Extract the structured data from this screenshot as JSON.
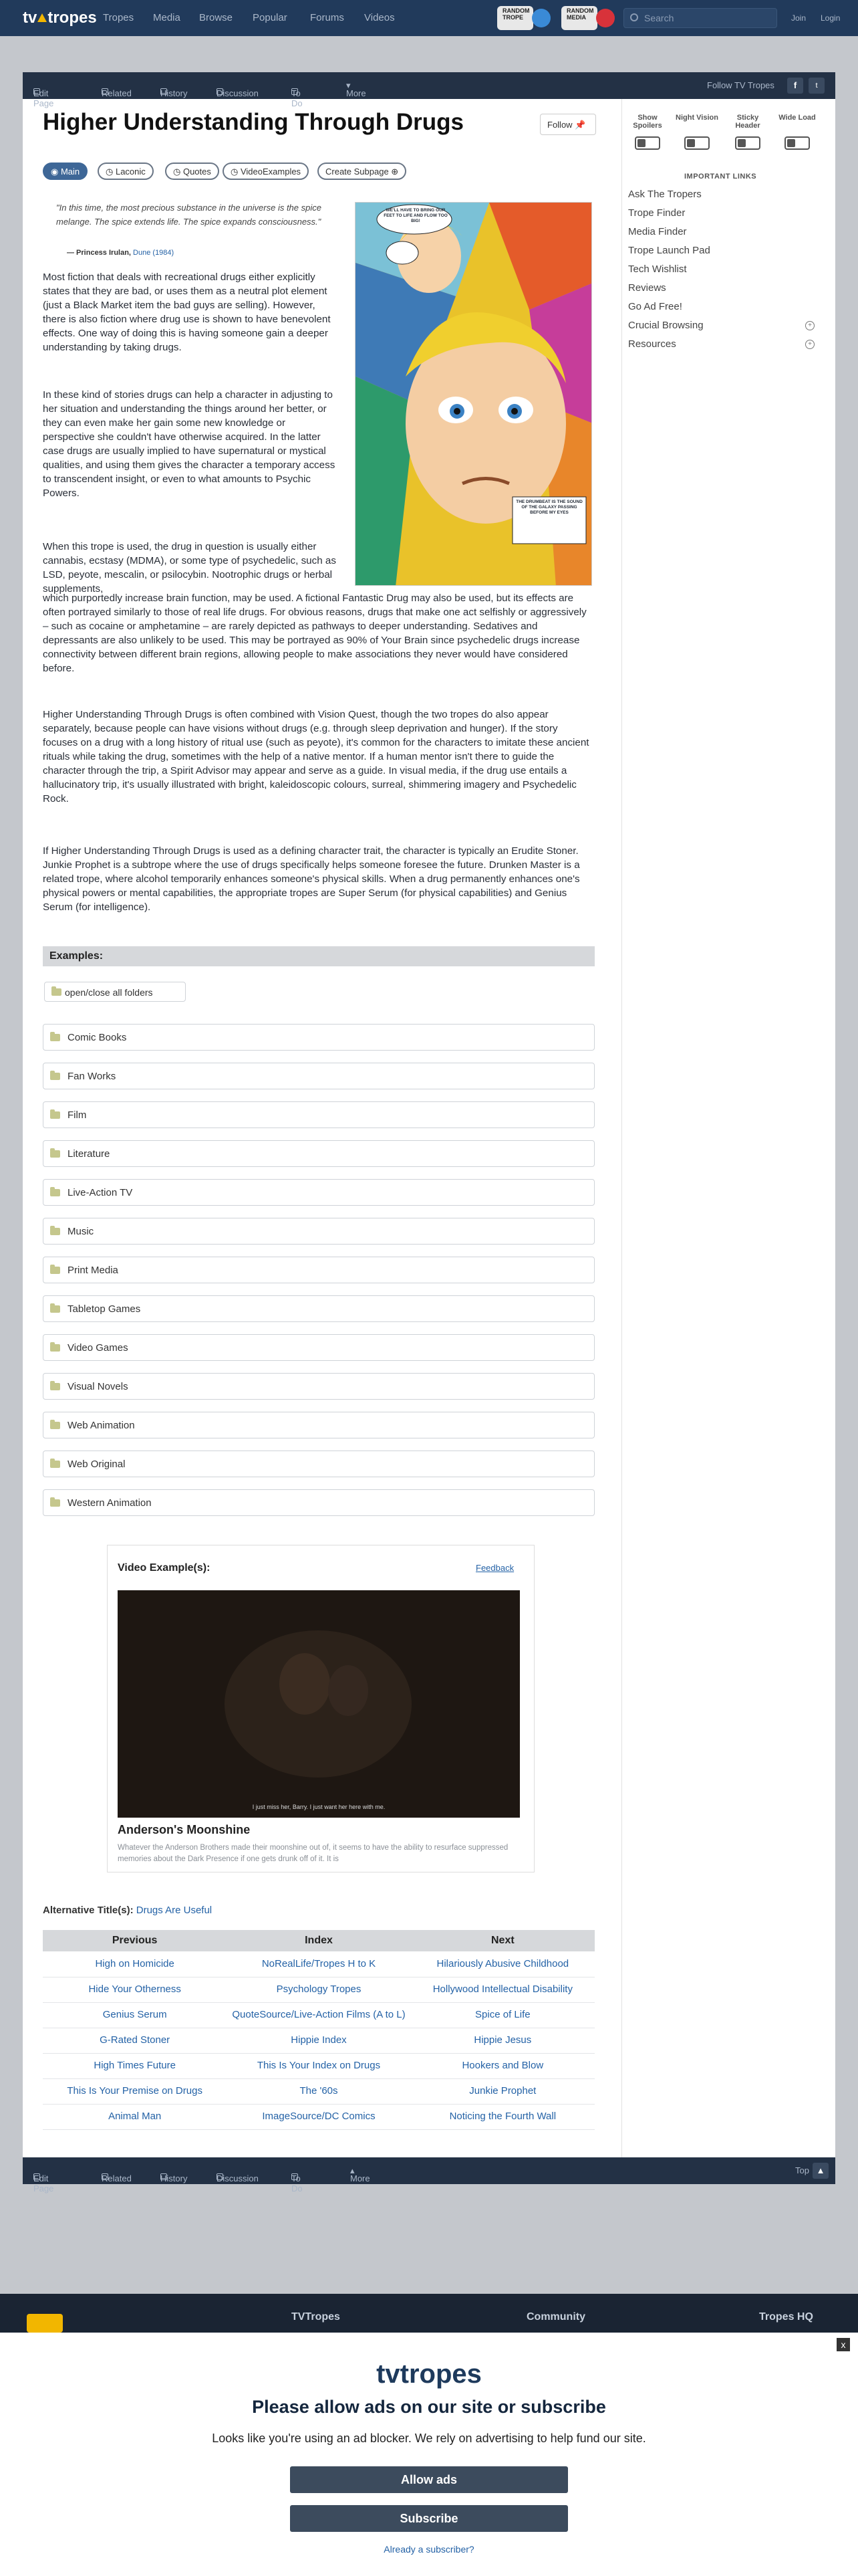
{
  "header": {
    "logo": "tvtropes",
    "nav": [
      "Tropes",
      "Media",
      "Browse",
      "Popular",
      "Forums",
      "Videos"
    ],
    "badge1": "RANDOM TROPE",
    "badge2": "RANDOM MEDIA",
    "search_placeholder": "Search",
    "join": "Join",
    "login": "Login"
  },
  "toolbar": {
    "edit": "Edit Page",
    "related": "Related",
    "history": "History",
    "discussion": "Discussion",
    "todo": "To Do",
    "more": "More",
    "follow": "Follow TV Tropes"
  },
  "page": {
    "title": "Higher Understanding Through Drugs",
    "follow_button": "Follow",
    "tabs": [
      "Main",
      "Laconic",
      "Quotes",
      "VideoExamples",
      "Create Subpage"
    ],
    "quote": "\"In this time, the most precious substance in the universe is the spice melange. The spice extends life. The spice expands consciousness.\"",
    "quote_attr_name": "— Princess Irulan,",
    "quote_attr_work": "Dune (1984)",
    "image_caption_1": "WE'LL HAVE TO BRING OUR FEET TO LIFE AND FLOW TOO BIG!",
    "image_caption_2": "THE DRUMBEAT IS THE SOUND OF THE GALAXY PASSING BEFORE MY EYES"
  },
  "paragraphs": [
    "Most fiction that deals with recreational drugs either explicitly states that they are bad, or uses them as a neutral plot element (just a Black Market item the bad guys are selling). However, there is also fiction where drug use is shown to have benevolent effects. One way of doing this is having someone gain a deeper understanding by taking drugs.",
    "In these kind of stories drugs can help a character in adjusting to her situation and understanding the things around her better, or they can even make her gain some new knowledge or perspective she couldn't have otherwise acquired. In the latter case drugs are usually implied to have supernatural or mystical qualities, and using them gives the character a temporary access to transcendent insight, or even to what amounts to Psychic Powers.",
    "When this trope is used, the drug in question is usually either cannabis, ecstasy (MDMA), or some type of psychedelic, such as LSD, peyote, mescalin, or psilocybin. Nootrophic drugs or herbal supplements,",
    "which purportedly increase brain function, may be used. A fictional Fantastic Drug may also be used, but its effects are often portrayed similarly to those of real life drugs. For obvious reasons, drugs that make one act selfishly or aggressively – such as cocaine or amphetamine – are rarely depicted as pathways to deeper understanding. Sedatives and depressants are also unlikely to be used. This may be portrayed as 90% of Your Brain since psychedelic drugs increase connectivity between different brain regions, allowing people to make associations they never would have considered before.",
    "Higher Understanding Through Drugs is often combined with Vision Quest, though the two tropes do also appear separately, because people can have visions without drugs (e.g. through sleep deprivation and hunger). If the story focuses on a drug with a long history of ritual use (such as peyote), it's common for the characters to imitate these ancient rituals while taking the drug, sometimes with the help of a native mentor. If a human mentor isn't there to guide the character through the trip, a Spirit Advisor may appear and serve as a guide. In visual media, if the drug use entails a hallucinatory trip, it's usually illustrated with bright, kaleidoscopic colours, surreal, shimmering imagery and Psychedelic Rock.",
    "If Higher Understanding Through Drugs is used as a defining character trait, the character is typically an Erudite Stoner. Junkie Prophet is a subtrope where the use of drugs specifically helps someone foresee the future. Drunken Master is a related trope, where alcohol temporarily enhances someone's physical skills. When a drug permanently enhances one's physical powers or mental capabilities, the appropriate tropes are Super Serum (for physical capabilities) and Genius Serum (for intelligence)."
  ],
  "examples": {
    "header": "Examples:",
    "open_all": "open/close all folders",
    "folders": [
      "Comic Books",
      "Fan Works",
      "Film",
      "Literature",
      "Live-Action TV",
      "Music",
      "Print Media",
      "Tabletop Games",
      "Video Games",
      "Visual Novels",
      "Web Animation",
      "Web Original",
      "Western Animation"
    ]
  },
  "video": {
    "header": "Video Example(s):",
    "feedback": "Feedback",
    "caption": "I just miss her, Barry. I just want her here with me.",
    "name": "Anderson's Moonshine",
    "description": "Whatever the Anderson Brothers made their moonshine out of, it seems to have the ability to resurface suppressed memories about the Dark Presence if one gets drunk off of it. It is"
  },
  "alt_title": {
    "label": "Alternative Title(s):",
    "value": "Drugs Are Useful"
  },
  "nav_table": {
    "headers": [
      "Previous",
      "Index",
      "Next"
    ],
    "rows": [
      [
        "High on Homicide",
        "NoRealLife/Tropes H to K",
        "Hilariously Abusive Childhood"
      ],
      [
        "Hide Your Otherness",
        "Psychology Tropes",
        "Hollywood Intellectual Disability"
      ],
      [
        "Genius Serum",
        "QuoteSource/Live-Action Films (A to L)",
        "Spice of Life"
      ],
      [
        "G-Rated Stoner",
        "Hippie Index",
        "Hippie Jesus"
      ],
      [
        "High Times Future",
        "This Is Your Index on Drugs",
        "Hookers and Blow"
      ],
      [
        "This Is Your Premise on Drugs",
        "The '60s",
        "Junkie Prophet"
      ],
      [
        "Animal Man",
        "ImageSource/DC Comics",
        "Noticing the Fourth Wall"
      ]
    ]
  },
  "bottom_toolbar": {
    "more": "More",
    "top": "Top"
  },
  "sidebar": {
    "options": [
      "Show Spoilers",
      "Night Vision",
      "Sticky Header",
      "Wide Load"
    ],
    "important_header": "IMPORTANT LINKS",
    "links": [
      "Ask The Tropers",
      "Trope Finder",
      "Media Finder",
      "Trope Launch Pad",
      "Tech Wishlist",
      "Reviews",
      "Go Ad Free!",
      "Crucial Browsing",
      "Resources"
    ]
  },
  "footer": {
    "col1": "TVTropes",
    "col2": "Community",
    "col3": "Tropes HQ"
  },
  "modal": {
    "logo": "tvtropes",
    "title": "Please allow ads on our site or subscribe",
    "text": "Looks like you're using an ad blocker. We rely on advertising to help fund our site.",
    "allow": "Allow ads",
    "subscribe": "Subscribe",
    "already": "Already a subscriber?",
    "close": "x"
  },
  "colors": {
    "topbar": "#213a5b",
    "link": "#2462a6",
    "toolbar": "#233145",
    "modal_button": "#3c4b5d"
  }
}
